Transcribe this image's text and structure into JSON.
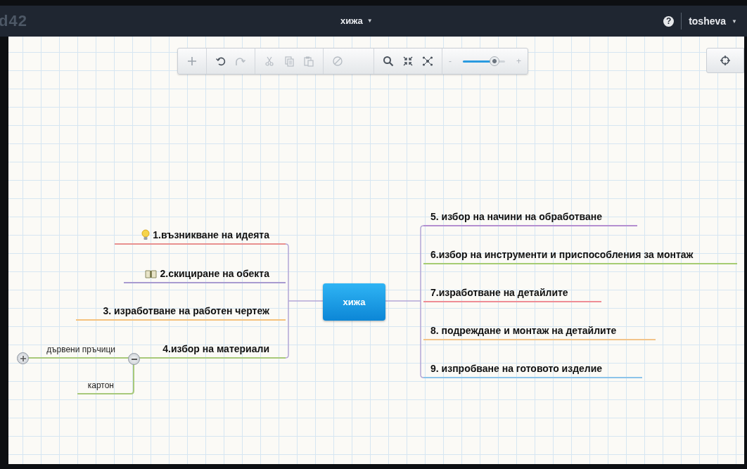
{
  "header": {
    "logo": "d42",
    "title": "хижа",
    "title_caret": "▼",
    "help": "?",
    "user": "tosheva",
    "user_caret": "▼"
  },
  "toolbar": {
    "zoom": {
      "minus": "-",
      "plus": "+",
      "level": 0.75
    }
  },
  "map": {
    "root": {
      "label": "хижа"
    },
    "left": [
      {
        "label": "1.възникване на идеята",
        "color": "#e8908f",
        "kind": "bulb"
      },
      {
        "label": "2.скициране на обекта",
        "color": "#a89bd0",
        "kind": "book"
      },
      {
        "label": "3. изработване на работен чертеж",
        "color": "#f5c27d",
        "kind": "plain"
      },
      {
        "label": "4.избор на материали",
        "color": "#a8c97a",
        "kind": "plain",
        "expanded": true,
        "children": [
          {
            "label": "дървени пръчици",
            "color": "#a8c97a",
            "expanded": false
          },
          {
            "label": "картон",
            "color": "#a8c97a"
          }
        ]
      }
    ],
    "right": [
      {
        "label": "5. избор на начини на обработване",
        "color": "#b48fd0"
      },
      {
        "label": "6.избор на инструменти и приспособления за монтаж",
        "color": "#a6cc72"
      },
      {
        "label": "7.изработване на детайлите",
        "color": "#ee8d95"
      },
      {
        "label": "8. подреждане и монтаж на детайлите",
        "color": "#f2c48a"
      },
      {
        "label": "9. изпробване на готовото изделие",
        "color": "#8cc4ea"
      }
    ]
  }
}
